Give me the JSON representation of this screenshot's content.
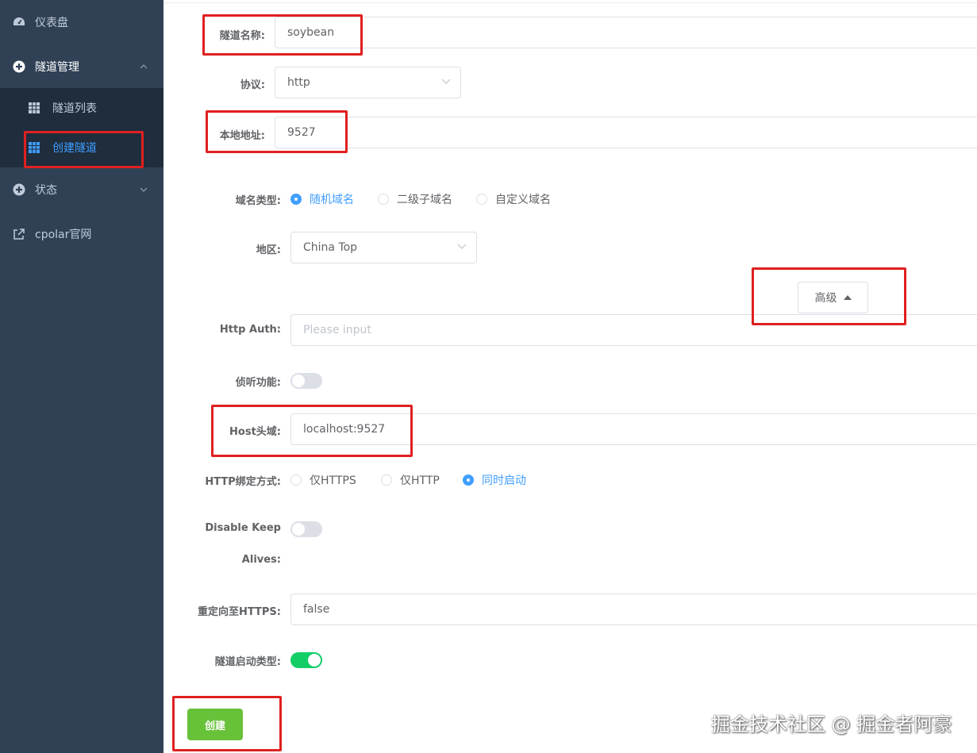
{
  "sidebar": {
    "items": [
      {
        "label": "仪表盘",
        "icon": "dashboard-icon"
      },
      {
        "label": "隧道管理",
        "icon": "tunnel-manage-icon"
      },
      {
        "label": "状态",
        "icon": "status-icon"
      },
      {
        "label": "cpolar官网",
        "icon": "external-link-icon"
      }
    ],
    "sub_items": [
      {
        "label": "隧道列表",
        "icon": "table-icon"
      },
      {
        "label": "创建隧道",
        "icon": "table-icon"
      }
    ]
  },
  "form": {
    "name_label": "隧道名称:",
    "name_value": "soybean",
    "protocol_label": "协议:",
    "protocol_value": "http",
    "local_label": "本地地址:",
    "local_value": "9527",
    "domain_type_label": "域名类型:",
    "domain_type_options": [
      "随机域名",
      "二级子域名",
      "自定义域名"
    ],
    "region_label": "地区:",
    "region_value": "China Top",
    "advanced_label": "高级",
    "http_auth_label": "Http Auth:",
    "http_auth_placeholder": "Please input",
    "inspect_label": "侦听功能:",
    "host_label": "Host头域:",
    "host_value": "localhost:9527",
    "bind_label": "HTTP绑定方式:",
    "bind_options": [
      "仅HTTPS",
      "仅HTTP",
      "同时启动"
    ],
    "keep_alive_label_1": "Disable Keep",
    "keep_alive_label_2": "Alives:",
    "redirect_label": "重定向至HTTPS:",
    "redirect_value": "false",
    "start_type_label": "隧道启动类型:",
    "create_label": "创建"
  },
  "state": {
    "domain_type_selected": "随机域名",
    "bind_selected": "同时启动",
    "inspect_on": false,
    "keep_alive_on": false,
    "start_type_on": true
  },
  "colors": {
    "sidebar_bg": "#304156",
    "submenu_bg": "#1f2d3d",
    "accent": "#409eff",
    "success": "#67c23a",
    "switch_on": "#13ce66",
    "highlight": "#e02020"
  },
  "watermark": "掘金技术社区 @ 掘金者阿豪"
}
